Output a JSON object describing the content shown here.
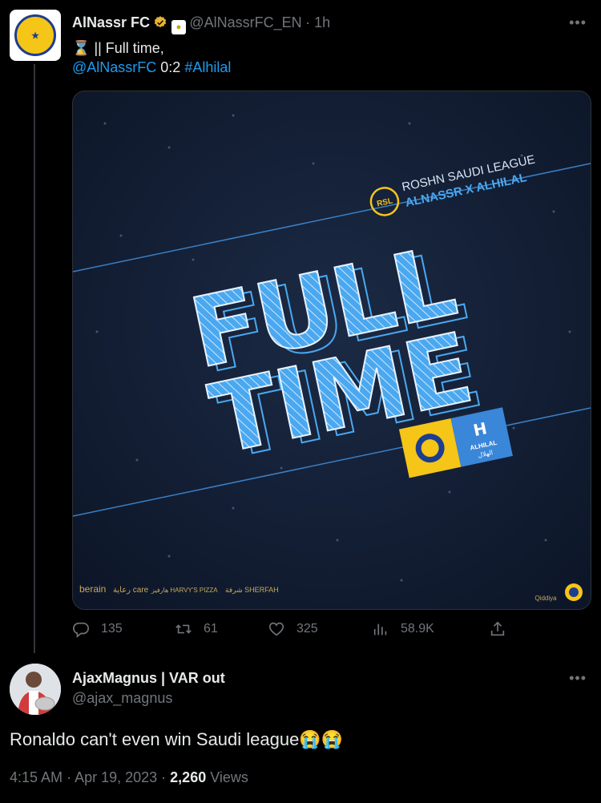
{
  "tweet": {
    "author_name": "AlNassr FC",
    "handle": "@AlNassrFC_EN",
    "time": "· 1h",
    "line1": "|| Full time,",
    "mention": "@AlNassrFC",
    "score": "0:2",
    "hashtag": "#Alhilal",
    "media": {
      "league": "ROSHN SAUDI LEAGUE",
      "match": "ALNASSR X ALHILAL",
      "rsl_badge": "RSL",
      "headline_1": "FULL",
      "headline_2": "TIME",
      "away_crest_text": "ALHILAL",
      "away_crest_arabic": "الهلال",
      "sponsors": [
        "berain",
        "رعاية care",
        "هارفيز HARVY'S PIZZA",
        "شرفة SHERFAH"
      ],
      "qiddiya": "Qiddiya"
    },
    "stats": {
      "replies": "135",
      "retweets": "61",
      "likes": "325",
      "views": "58.9K"
    }
  },
  "reply": {
    "author_name": "AjaxMagnus | VAR out",
    "handle": "@ajax_magnus",
    "text": "Ronaldo can't even win Saudi league😭😭",
    "time": "4:15 AM",
    "date": "Apr 19, 2023",
    "views_count": "2,260",
    "views_label": "Views"
  },
  "colors": {
    "background": "#000000",
    "text": "#e7e9ea",
    "muted": "#71767b",
    "link": "#1d9bf0",
    "poster_bg": "#0f1a2e",
    "poster_blue": "#4aa8f0",
    "gold": "#f5c518"
  },
  "icons": [
    "verified-badge-icon",
    "club-crest-icon",
    "hourglass-icon",
    "more-icon",
    "reply-icon",
    "retweet-icon",
    "like-icon",
    "views-icon",
    "share-icon"
  ]
}
